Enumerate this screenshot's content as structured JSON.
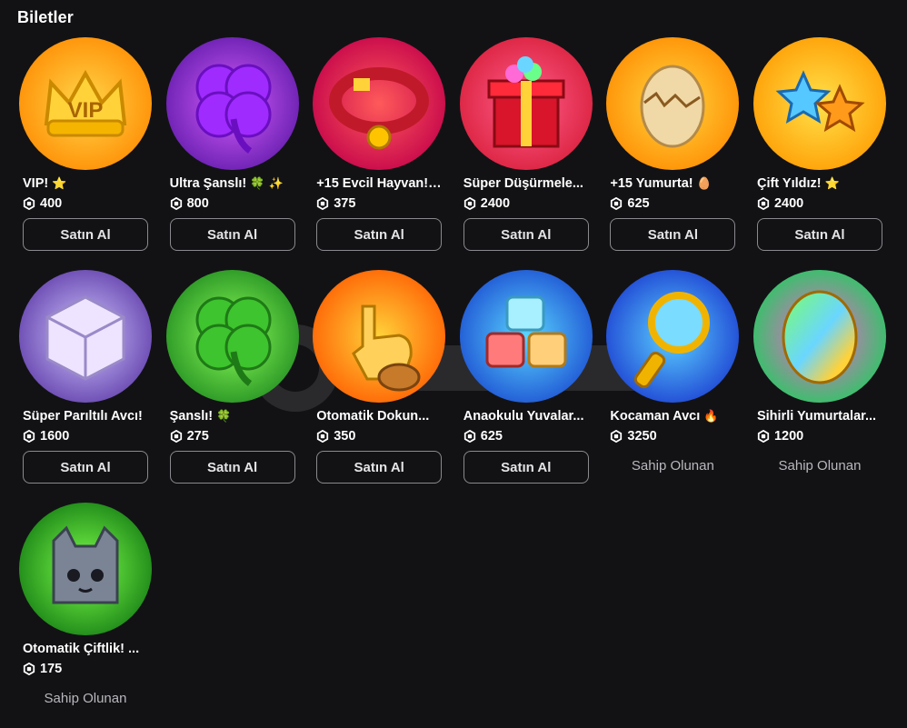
{
  "section": {
    "title": "Biletler"
  },
  "labels": {
    "buy": "Satın Al",
    "owned": "Sahip Olunan"
  },
  "passes": [
    {
      "name": "VIP! ",
      "emoji": "⭐",
      "price": "400",
      "status": "buy",
      "icon": "vip-crown-icon",
      "bg": [
        "#ffd54a",
        "#ff8a00"
      ]
    },
    {
      "name": "Ultra Şanslı! ",
      "emoji": "🍀 ✨",
      "price": "800",
      "status": "buy",
      "icon": "purple-clover-icon",
      "bg": [
        "#d65cff",
        "#5e1aa8"
      ]
    },
    {
      "name": "+15 Evcil Hayvan! ...",
      "emoji": "",
      "price": "375",
      "status": "buy",
      "icon": "pet-collar-icon",
      "bg": [
        "#ff5a5a",
        "#c2004a"
      ]
    },
    {
      "name": "Süper Düşürmele...",
      "emoji": "",
      "price": "2400",
      "status": "buy",
      "icon": "gift-box-icon",
      "bg": [
        "#ff5f8a",
        "#d81d3a"
      ]
    },
    {
      "name": "+15 Yumurta! ",
      "emoji": "🥚",
      "price": "625",
      "status": "buy",
      "icon": "cracked-egg-icon",
      "bg": [
        "#ffd740",
        "#ff8a00"
      ]
    },
    {
      "name": "Çift Yıldız! ",
      "emoji": "⭐",
      "price": "2400",
      "status": "buy",
      "icon": "double-star-icon",
      "bg": [
        "#ffe14a",
        "#ff9a00"
      ]
    },
    {
      "name": "Süper Parıltılı Avcı! ",
      "emoji": "",
      "price": "1600",
      "status": "buy",
      "icon": "shiny-dice-icon",
      "bg": [
        "#d0c8ff",
        "#5e3aa8"
      ]
    },
    {
      "name": "Şanslı! ",
      "emoji": "🍀",
      "price": "275",
      "status": "buy",
      "icon": "green-clover-icon",
      "bg": [
        "#8dff5a",
        "#1f8a1f"
      ]
    },
    {
      "name": "Otomatik Dokun...",
      "emoji": "",
      "price": "350",
      "status": "buy",
      "icon": "tap-hand-icon",
      "bg": [
        "#ffd23a",
        "#ff5a00"
      ]
    },
    {
      "name": "Anaokulu Yuvalar...",
      "emoji": "",
      "price": "625",
      "status": "buy",
      "icon": "cubes-icon",
      "bg": [
        "#5ad6ff",
        "#1a4ad0"
      ]
    },
    {
      "name": "Kocaman Avcı ",
      "emoji": "🔥",
      "price": "3250",
      "status": "owned",
      "icon": "magnifier-icon",
      "bg": [
        "#5ad0ff",
        "#1a3ad0"
      ]
    },
    {
      "name": "Sihirli Yumurtalar...",
      "emoji": "",
      "price": "1200",
      "status": "owned",
      "icon": "rainbow-egg-icon",
      "bg": [
        "#ff5ad6",
        "#1ad05a"
      ]
    },
    {
      "name": "Otomatik Çiftlik! ...",
      "emoji": "",
      "price": "175",
      "status": "owned",
      "icon": "cat-pet-icon",
      "bg": [
        "#7dff4a",
        "#137a13"
      ]
    }
  ],
  "colors": {
    "background": "#121215",
    "text": "#ffffff",
    "button_border": "#8a8a8e",
    "owned_text": "#b8b8bd"
  }
}
